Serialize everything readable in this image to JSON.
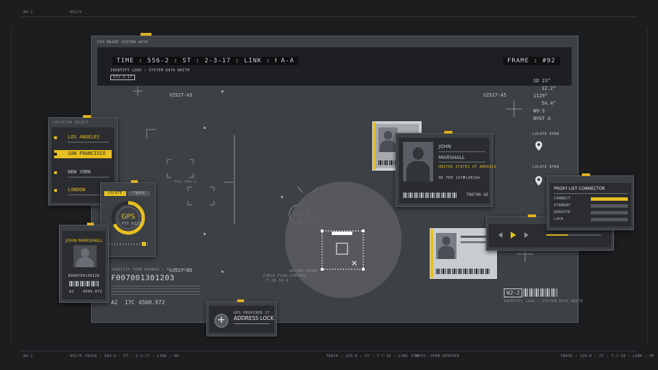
{
  "frame": {
    "top_left_code": "AA-1",
    "top_left_code2": "992/K",
    "bottom_left_code": "AA-1",
    "bottom_left_code2": "992/K",
    "status_left": "TRACK : 999-3 : ST : 2-3-17 : LINK : HH",
    "status_mid": "TRACK : 226-8 : ST : 7-7-18 : LINK : HF",
    "status_right": "STATUS: OPEN UPDATED",
    "status_far": "TRACK : 226-8 : ST : 7-7-18 : LINK : HF"
  },
  "main": {
    "window_title": "FPS MAINT SYSTEM DATA",
    "time_readout": "TIME : 556-2 : ST : 2-3-17 : LINK : HH",
    "mode": "A-A",
    "frame_readout": "FRAME : #92",
    "identify_label": "IDENTIFY LOAD : SYSTEM DATA WRITE",
    "identify_code": "572-3-17",
    "marker_top": "V2527-A5",
    "marker_top_right": "V2527-A5",
    "marker_bottom": "V2527-A5",
    "stats": [
      "SD 23°",
      "12.2°",
      "1129°",
      "54.4°",
      "WO-3",
      "NVGT A"
    ],
    "locate_label_1": "LOCATE OPEN",
    "locate_label_2": "LOCATE OPEN",
    "pos_label": "FPS-393.3",
    "id_label": "IDENTITY FORM NUMBER / ML SQ LAND",
    "id_number": "F007001301203",
    "id_footer": [
      "A2",
      "17C",
      "4500.972"
    ],
    "nature_label": "NATURE POINT",
    "target_label": "FIELD FLOW CONTROL",
    "target_coord": "F-20.39.4",
    "w_code": "W2-2",
    "w_sub": "IDENTITY LOAD : SYSTEM DATA WRITE"
  },
  "cities": {
    "title": "LOCATION SELECT",
    "items": [
      "LOS ANGELES",
      "SAN FRANCISCO",
      "NEW YORK",
      "LONDON"
    ],
    "selected_index": 1
  },
  "gps": {
    "label": "GPS",
    "sub": "FTT 0123",
    "tab_left": "LOCATE",
    "tab_right": "TRACK",
    "progress": 0.68
  },
  "id_card_left": {
    "name": "JOHN MARSHALL",
    "number": "8900700130120",
    "footer_left": "A2",
    "footer_right": "4500.972"
  },
  "address": {
    "small": "GPS PROVIDER 17",
    "label": "ADDRESS LOCK",
    "button_icon": "plus-icon"
  },
  "profile": {
    "first": "JOHN",
    "last": "MARSHALL",
    "country": "UNITED STATES OF AMERICA",
    "field1": "NE FEB 1978",
    "field2": "FLORIDA",
    "code": "T00700-SE"
  },
  "proxy": {
    "title": "PROXY LIST CONNECTOR",
    "rows": [
      "CONNECT",
      "STANDBY",
      "REROUTE",
      "LOCK"
    ]
  },
  "player": {
    "buttons": [
      "rewind-icon",
      "play-icon",
      "forward-icon"
    ]
  },
  "colors": {
    "accent": "#e6bf1f",
    "panel": "#3c3f44",
    "bg": "#1c1d1f"
  }
}
